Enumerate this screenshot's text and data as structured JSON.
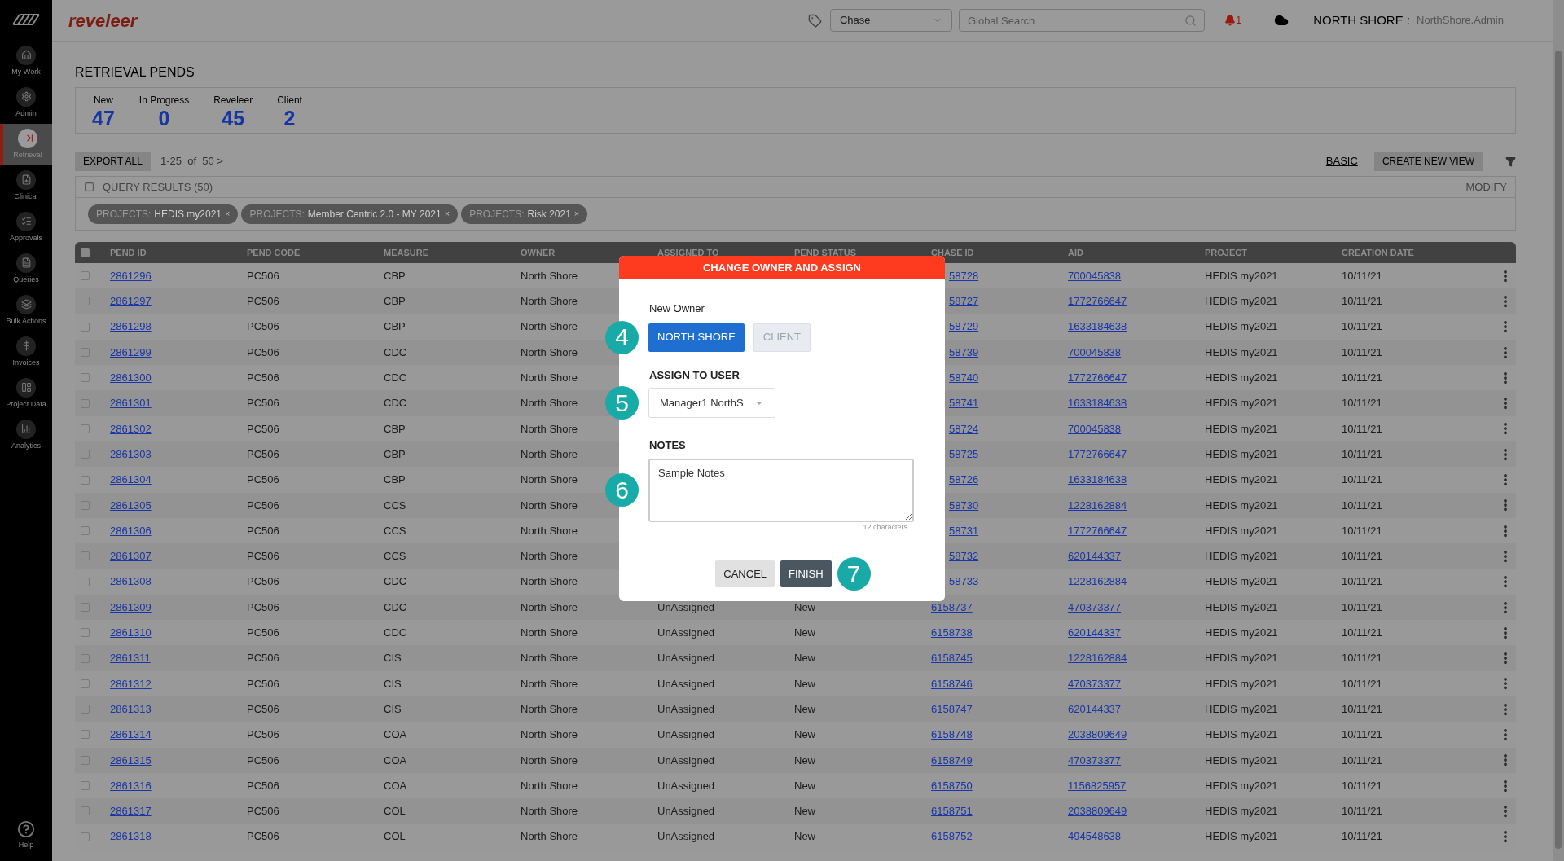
{
  "sidebar": {
    "items": [
      {
        "label": "My Work",
        "selected": false
      },
      {
        "label": "Admin",
        "selected": false
      },
      {
        "label": "Retrieval",
        "selected": true
      },
      {
        "label": "Clinical",
        "selected": false
      },
      {
        "label": "Approvals",
        "selected": false
      },
      {
        "label": "Queries",
        "selected": false
      },
      {
        "label": "Bulk Actions",
        "selected": false
      },
      {
        "label": "Invoices",
        "selected": false
      },
      {
        "label": "Project Data",
        "selected": false
      },
      {
        "label": "Analytics",
        "selected": false
      }
    ],
    "help": "Help"
  },
  "header": {
    "logo": "reveleer",
    "select_value": "Chase",
    "search_placeholder": "Global Search",
    "notification_count": "1",
    "org": "NORTH SHORE :",
    "user": "NorthShore.Admin"
  },
  "page_title": "RETRIEVAL PENDS",
  "summary": [
    {
      "label": "New",
      "value": "47"
    },
    {
      "label": "In Progress",
      "value": "0"
    },
    {
      "label": "Reveleer",
      "value": "45"
    },
    {
      "label": "Client",
      "value": "2"
    }
  ],
  "toolbar": {
    "export": "EXPORT ALL",
    "pagination": "1-25  of  50 >",
    "basic": "BASIC",
    "create_view": "CREATE NEW VIEW"
  },
  "query": {
    "title": "QUERY RESULTS (50)",
    "modify": "MODIFY",
    "chips": [
      {
        "key": "PROJECTS:",
        "value": "HEDIS my2021",
        "remove": "×"
      },
      {
        "key": "PROJECTS:",
        "value": "Member Centric 2.0 - MY 2021",
        "remove": "×"
      },
      {
        "key": "PROJECTS:",
        "value": "Risk 2021",
        "remove": "×"
      }
    ]
  },
  "table": {
    "all_checked": false,
    "columns": [
      "PEND ID",
      "PEND CODE",
      "MEASURE",
      "OWNER",
      "ASSIGNED TO",
      "PEND STATUS",
      "CHASE ID",
      "AID",
      "PROJECT",
      "CREATION DATE"
    ],
    "rows": [
      {
        "checked": false,
        "pend_id": "2861296",
        "pend_code": "PC506",
        "measure": "CBP",
        "owner": "North Shore",
        "chase_id": "58728",
        "aid": "700045838",
        "project": "HEDIS my2021",
        "date": "10/11/21"
      },
      {
        "checked": false,
        "pend_id": "2861297",
        "pend_code": "PC506",
        "measure": "CBP",
        "owner": "North Shore",
        "chase_id": "58727",
        "aid": "1772766647",
        "project": "HEDIS my2021",
        "date": "10/11/21"
      },
      {
        "checked": false,
        "pend_id": "2861298",
        "pend_code": "PC506",
        "measure": "CBP",
        "owner": "North Shore",
        "chase_id": "58729",
        "aid": "1633184638",
        "project": "HEDIS my2021",
        "date": "10/11/21"
      },
      {
        "checked": false,
        "pend_id": "2861299",
        "pend_code": "PC506",
        "measure": "CDC",
        "owner": "North Shore",
        "chase_id": "58739",
        "aid": "700045838",
        "project": "HEDIS my2021",
        "date": "10/11/21"
      },
      {
        "checked": false,
        "pend_id": "2861300",
        "pend_code": "PC506",
        "measure": "CDC",
        "owner": "North Shore",
        "chase_id": "58740",
        "aid": "1772766647",
        "project": "HEDIS my2021",
        "date": "10/11/21"
      },
      {
        "checked": false,
        "pend_id": "2861301",
        "pend_code": "PC506",
        "measure": "CDC",
        "owner": "North Shore",
        "chase_id": "58741",
        "aid": "1633184638",
        "project": "HEDIS my2021",
        "date": "10/11/21"
      },
      {
        "checked": false,
        "pend_id": "2861302",
        "pend_code": "PC506",
        "measure": "CBP",
        "owner": "North Shore",
        "chase_id": "58724",
        "aid": "700045838",
        "project": "HEDIS my2021",
        "date": "10/11/21"
      },
      {
        "checked": false,
        "pend_id": "2861303",
        "pend_code": "PC506",
        "measure": "CBP",
        "owner": "North Shore",
        "chase_id": "58725",
        "aid": "1772766647",
        "project": "HEDIS my2021",
        "date": "10/11/21"
      },
      {
        "checked": false,
        "pend_id": "2861304",
        "pend_code": "PC506",
        "measure": "CBP",
        "owner": "North Shore",
        "chase_id": "58726",
        "aid": "1633184638",
        "project": "HEDIS my2021",
        "date": "10/11/21"
      },
      {
        "checked": false,
        "pend_id": "2861305",
        "pend_code": "PC506",
        "measure": "CCS",
        "owner": "North Shore",
        "chase_id": "58730",
        "aid": "1228162884",
        "project": "HEDIS my2021",
        "date": "10/11/21"
      },
      {
        "checked": false,
        "pend_id": "2861306",
        "pend_code": "PC506",
        "measure": "CCS",
        "owner": "North Shore",
        "chase_id": "58731",
        "aid": "1772766647",
        "project": "HEDIS my2021",
        "date": "10/11/21"
      },
      {
        "checked": false,
        "pend_id": "2861307",
        "pend_code": "PC506",
        "measure": "CCS",
        "owner": "North Shore",
        "chase_id": "58732",
        "aid": "620144337",
        "project": "HEDIS my2021",
        "date": "10/11/21"
      },
      {
        "checked": false,
        "pend_id": "2861308",
        "pend_code": "PC506",
        "measure": "CDC",
        "owner": "North Shore",
        "chase_id": "58733",
        "aid": "1228162884",
        "project": "HEDIS my2021",
        "date": "10/11/21"
      },
      {
        "checked": false,
        "pend_id": "2861309",
        "pend_code": "PC506",
        "measure": "CDC",
        "owner": "North Shore",
        "assigned_to": "UnAssigned",
        "status": "New",
        "chase_id": "6158737",
        "aid": "470373377",
        "project": "HEDIS my2021",
        "date": "10/11/21"
      },
      {
        "checked": false,
        "pend_id": "2861310",
        "pend_code": "PC506",
        "measure": "CDC",
        "owner": "North Shore",
        "assigned_to": "UnAssigned",
        "status": "New",
        "chase_id": "6158738",
        "aid": "620144337",
        "project": "HEDIS my2021",
        "date": "10/11/21"
      },
      {
        "checked": false,
        "pend_id": "2861311",
        "pend_code": "PC506",
        "measure": "CIS",
        "owner": "North Shore",
        "assigned_to": "UnAssigned",
        "status": "New",
        "chase_id": "6158745",
        "aid": "1228162884",
        "project": "HEDIS my2021",
        "date": "10/11/21"
      },
      {
        "checked": false,
        "pend_id": "2861312",
        "pend_code": "PC506",
        "measure": "CIS",
        "owner": "North Shore",
        "assigned_to": "UnAssigned",
        "status": "New",
        "chase_id": "6158746",
        "aid": "470373377",
        "project": "HEDIS my2021",
        "date": "10/11/21"
      },
      {
        "checked": false,
        "pend_id": "2861313",
        "pend_code": "PC506",
        "measure": "CIS",
        "owner": "North Shore",
        "assigned_to": "UnAssigned",
        "status": "New",
        "chase_id": "6158747",
        "aid": "620144337",
        "project": "HEDIS my2021",
        "date": "10/11/21"
      },
      {
        "checked": false,
        "pend_id": "2861314",
        "pend_code": "PC506",
        "measure": "COA",
        "owner": "North Shore",
        "assigned_to": "UnAssigned",
        "status": "New",
        "chase_id": "6158748",
        "aid": "2038809649",
        "project": "HEDIS my2021",
        "date": "10/11/21"
      },
      {
        "checked": false,
        "pend_id": "2861315",
        "pend_code": "PC506",
        "measure": "COA",
        "owner": "North Shore",
        "assigned_to": "UnAssigned",
        "status": "New",
        "chase_id": "6158749",
        "aid": "470373377",
        "project": "HEDIS my2021",
        "date": "10/11/21"
      },
      {
        "checked": false,
        "pend_id": "2861316",
        "pend_code": "PC506",
        "measure": "COA",
        "owner": "North Shore",
        "assigned_to": "UnAssigned",
        "status": "New",
        "chase_id": "6158750",
        "aid": "1156825957",
        "project": "HEDIS my2021",
        "date": "10/11/21"
      },
      {
        "checked": false,
        "pend_id": "2861317",
        "pend_code": "PC506",
        "measure": "COL",
        "owner": "North Shore",
        "assigned_to": "UnAssigned",
        "status": "New",
        "chase_id": "6158751",
        "aid": "2038809649",
        "project": "HEDIS my2021",
        "date": "10/11/21"
      },
      {
        "checked": false,
        "pend_id": "2861318",
        "pend_code": "PC506",
        "measure": "COL",
        "owner": "North Shore",
        "assigned_to": "UnAssigned",
        "status": "New",
        "chase_id": "6158752",
        "aid": "494548638",
        "project": "HEDIS my2021",
        "date": "10/11/21"
      }
    ]
  },
  "dialog": {
    "title": "CHANGE OWNER AND ASSIGN",
    "owner_label": "New Owner",
    "owner_options": [
      {
        "label": "NORTH SHORE",
        "selected": true
      },
      {
        "label": "CLIENT",
        "selected": false
      }
    ],
    "assign_label": "ASSIGN TO USER",
    "assign_value": "Manager1 NorthS",
    "notes_label": "NOTES",
    "notes_value": "Sample Notes",
    "char_count": "12 characters",
    "cancel": "CANCEL",
    "finish": "FINISH",
    "steps": [
      {
        "label": "4",
        "color": "#17aaa7"
      },
      {
        "label": "5",
        "color": "#17aaa7"
      },
      {
        "label": "6",
        "color": "#17aaa7"
      },
      {
        "label": "7",
        "color": "#17aaa7"
      }
    ]
  }
}
